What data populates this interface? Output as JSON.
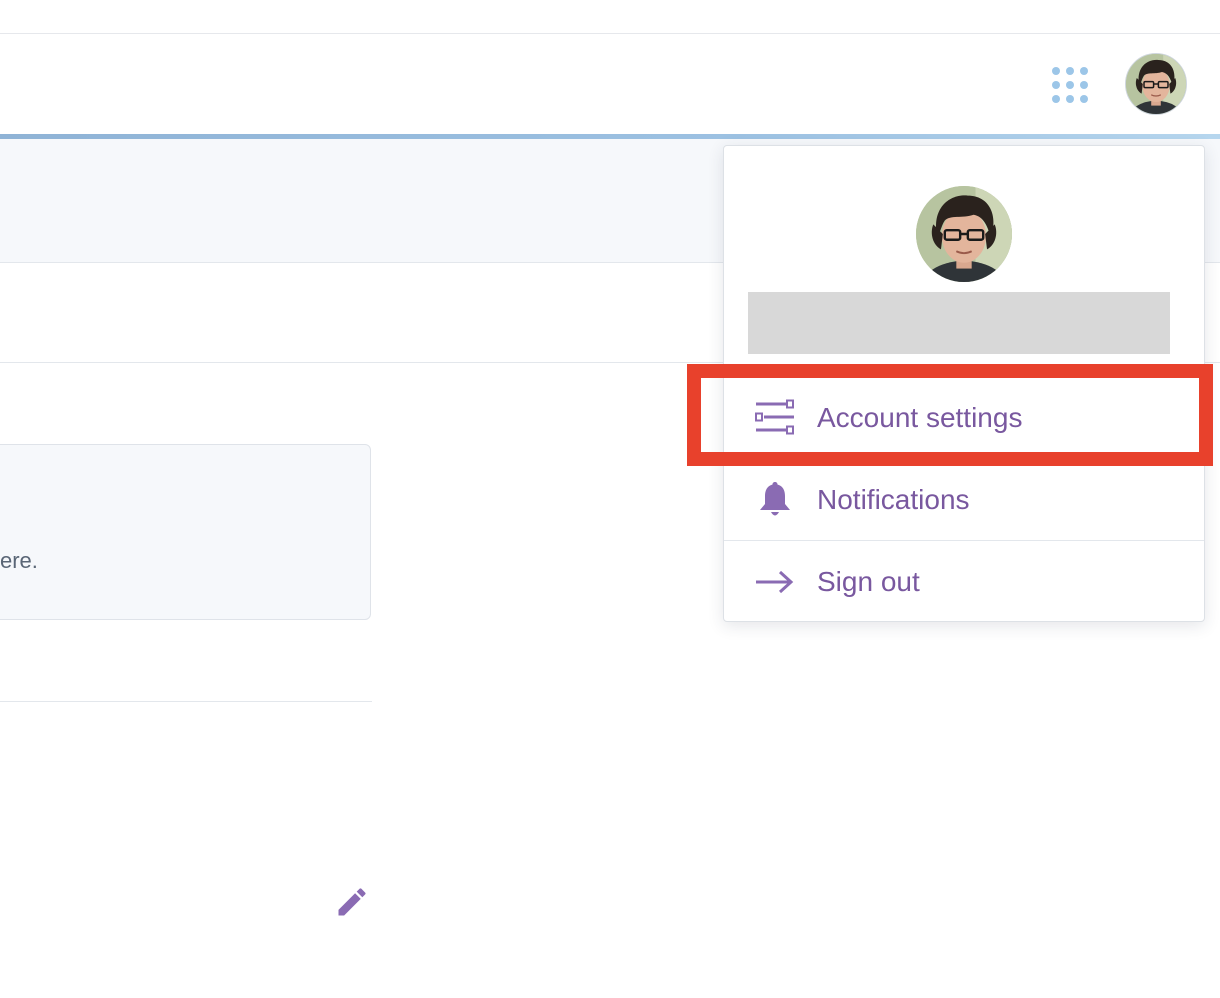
{
  "header": {
    "apps_icon": "apps-grid-icon",
    "avatar_alt": "user avatar"
  },
  "content": {
    "card_text_fragment": "ere.",
    "edit_icon": "pencil-icon"
  },
  "account_menu": {
    "avatar_icon": "user-avatar",
    "items": [
      {
        "label": "Account settings",
        "icon": "settings-sliders-icon"
      },
      {
        "label": "Notifications",
        "icon": "bell-icon"
      },
      {
        "label": "Sign out",
        "icon": "arrow-right-icon"
      }
    ]
  },
  "colors": {
    "menu_accent": "#79589f",
    "highlight": "#e8412c",
    "header_accent": "#9cc1e2",
    "apps_dots": "#9cc6e8"
  }
}
